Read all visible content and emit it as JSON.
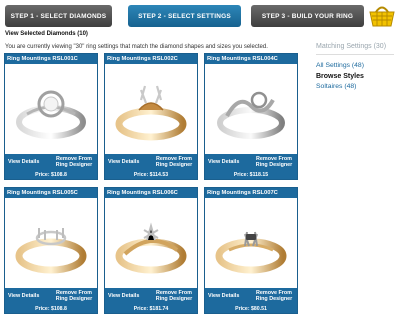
{
  "steps": [
    {
      "label": "STEP 1 - SELECT DIAMONDS"
    },
    {
      "label": "STEP 2 - SELECT SETTINGS"
    },
    {
      "label": "STEP 3 - BUILD YOUR RING"
    }
  ],
  "header": {
    "view_selected": "View Selected Diamonds (10)",
    "viewing_text": "You are currently viewing \"30\" ring settings that match the diamond shapes and sizes you selected."
  },
  "cards": [
    {
      "title": "Ring Mountings RSL001C",
      "price": "Price: $108.8",
      "metal": "silver",
      "view": "View Details",
      "remove": "Remove From Ring Designer"
    },
    {
      "title": "Ring Mountings RSL002C",
      "price": "Price: $114.53",
      "metal": "gold",
      "view": "View Details",
      "remove": "Remove From Ring Designer"
    },
    {
      "title": "Ring Mountings RSL004C",
      "price": "Price: $118.15",
      "metal": "silver",
      "view": "View Details",
      "remove": "Remove From Ring Designer"
    },
    {
      "title": "Ring Mountings RSL005C",
      "price": "Price: $108.8",
      "metal": "gold",
      "view": "View Details",
      "remove": "Remove From Ring Designer"
    },
    {
      "title": "Ring Mountings RSL006C",
      "price": "Price: $181.74",
      "metal": "gold",
      "view": "View Details",
      "remove": "Remove From Ring Designer"
    },
    {
      "title": "Ring Mountings RSL007C",
      "price": "Price: $80.51",
      "metal": "gold",
      "view": "View Details",
      "remove": "Remove From Ring Designer"
    }
  ],
  "sidebar": {
    "matching": "Matching Settings (30)",
    "all_settings": "All Settings (48)",
    "browse_styles": "Browse Styles",
    "solitaire": "Soltaires (48)"
  },
  "colors": {
    "brand_blue": "#1d6a9e",
    "basket_yellow": "#f2c200"
  }
}
